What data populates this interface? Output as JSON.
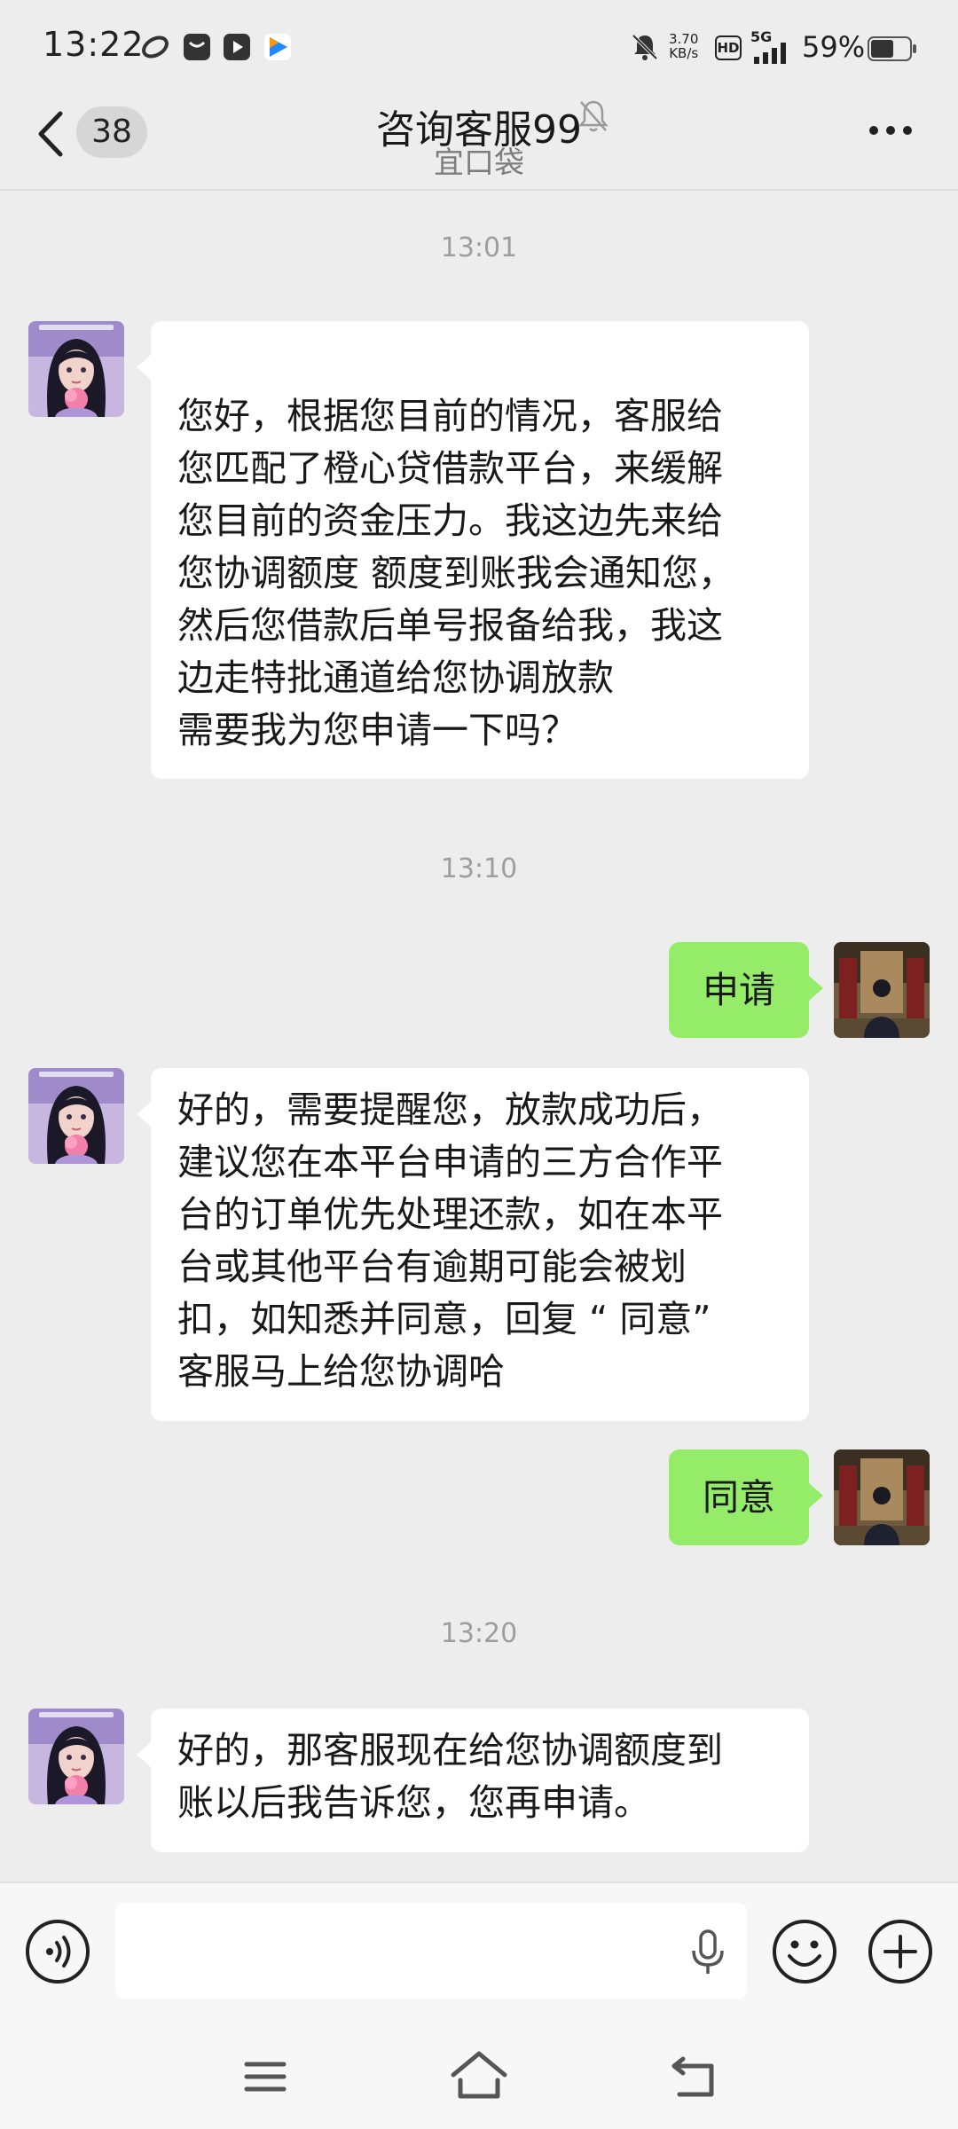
{
  "status_bar": {
    "time": "13:22",
    "net_speed_value": "3.70",
    "net_speed_unit": "KB/s",
    "hd_label": "HD",
    "network_label": "5G",
    "battery": "59%"
  },
  "header": {
    "unread_count": "38",
    "title": "咨询客服99",
    "subtitle": "宜口袋"
  },
  "messages": [
    {
      "timestamp": "13:01",
      "sender": "agent",
      "text": "您好，根据您目前的情况，客服给\n您匹配了橙心贷借款平台，来缓解\n您目前的资金压力。我这边先来给\n您协调额度 额度到账我会通知您，\n然后您借款后单号报备给我，我这\n边走特批通道给您协调放款\n需要我为您申请一下吗？"
    },
    {
      "timestamp": "13:10",
      "sender": "me",
      "text": "申请"
    },
    {
      "sender": "agent",
      "text": "好的，需要提醒您，放款成功后，\n建议您在本平台申请的三方合作平\n台的订单优先处理还款，如在本平\n台或其他平台有逾期可能会被划\n扣，如知悉并同意，回复 “ 同意”\n客服马上给您协调哈"
    },
    {
      "sender": "me",
      "text": "同意"
    },
    {
      "timestamp": "13:20",
      "sender": "agent",
      "text": "好的，那客服现在给您协调额度到\n账以后我告诉您，您再申请。"
    }
  ],
  "colors": {
    "chat_background": "#ededed",
    "agent_bubble": "#ffffff",
    "my_bubble": "#95ec69",
    "timestamp_text": "#9e9e9e"
  },
  "icons": {
    "back": "chevron-left-icon",
    "mute": "bell-off-icon",
    "more": "more-dots-icon",
    "voice": "voice-mode-icon",
    "mic": "microphone-icon",
    "emoji": "emoji-icon",
    "add": "plus-circle-icon"
  }
}
